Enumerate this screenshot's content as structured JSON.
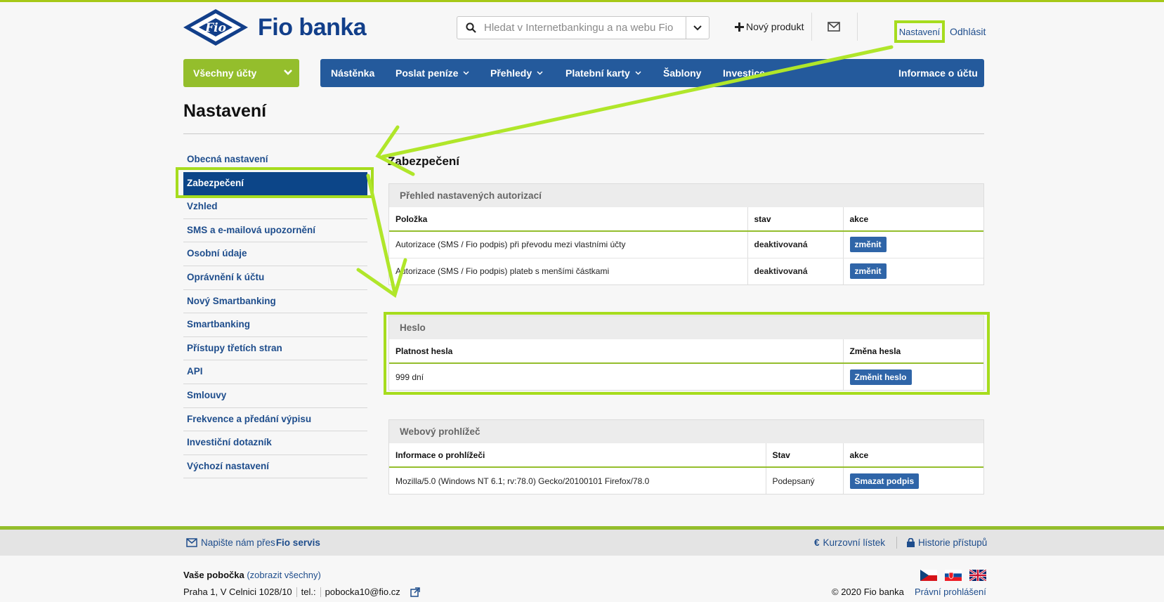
{
  "header": {
    "brand": "Fio banka",
    "logo_text": "Fio",
    "search_placeholder": "Hledat v Internetbankingu a na webu Fio",
    "new_product": "Nový produkt",
    "settings_link": "Nastavení",
    "logout_link": "Odhlásit"
  },
  "nav": {
    "accounts": "Všechny účty",
    "items": [
      "Nástěnka",
      "Poslat peníze",
      "Přehledy",
      "Platební karty",
      "Šablony",
      "Investice"
    ],
    "account_info": "Informace o účtu"
  },
  "page_title": "Nastavení",
  "sidebar": {
    "items": [
      "Obecná nastavení",
      "Zabezpečení",
      "Vzhled",
      "SMS a e-mailová upozornění",
      "Osobní údaje",
      "Oprávnění k účtu",
      "Nový Smartbanking",
      "Smartbanking",
      "Přístupy třetích stran",
      "API",
      "Smlouvy",
      "Frekvence a předání výpisu",
      "Investiční dotazník",
      "Výchozí nastavení"
    ],
    "active_index": 1
  },
  "section_title": "Zabezpečení",
  "authorizations": {
    "title": "Přehled nastavených autorizací",
    "columns": [
      "Položka",
      "stav",
      "akce"
    ],
    "rows": [
      {
        "item": "Autorizace (SMS / Fio podpis) při převodu mezi vlastními účty",
        "state": "deaktivovaná",
        "action": "změnit"
      },
      {
        "item": "Autorizace (SMS / Fio podpis) plateb s menšími částkami",
        "state": "deaktivovaná",
        "action": "změnit"
      }
    ]
  },
  "password": {
    "title": "Heslo",
    "columns": [
      "Platnost hesla",
      "Změna hesla"
    ],
    "validity": "999 dní",
    "action": "Změnit heslo"
  },
  "browser": {
    "title": "Webový prohlížeč",
    "columns": [
      "Informace o prohlížeči",
      "Stav",
      "akce"
    ],
    "info": "Mozilla/5.0 (Windows NT 6.1; rv:78.0) Gecko/20100101 Firefox/78.0",
    "state": "Podepsaný",
    "action": "Smazat podpis"
  },
  "footer": {
    "write_us": "Napište nám přes ",
    "write_us_bold": "Fio servis",
    "rates": "Kurzovní lístek",
    "history": "Historie přístupů",
    "branch_label": "Vaše pobočka",
    "branch_link": "(zobrazit všechny)",
    "address": "Praha 1, V Celnici 1028/10",
    "tel": "tel.:",
    "email": "pobocka10@fio.cz",
    "copyright": "© 2020 Fio banka",
    "legal": "Právní prohlášení"
  },
  "colors": {
    "accent_green": "#94be2c",
    "highlight_green": "#a6dc1e",
    "nav_blue": "#245a9c",
    "active_blue": "#0c4588",
    "link_blue": "#1e4d8c"
  }
}
